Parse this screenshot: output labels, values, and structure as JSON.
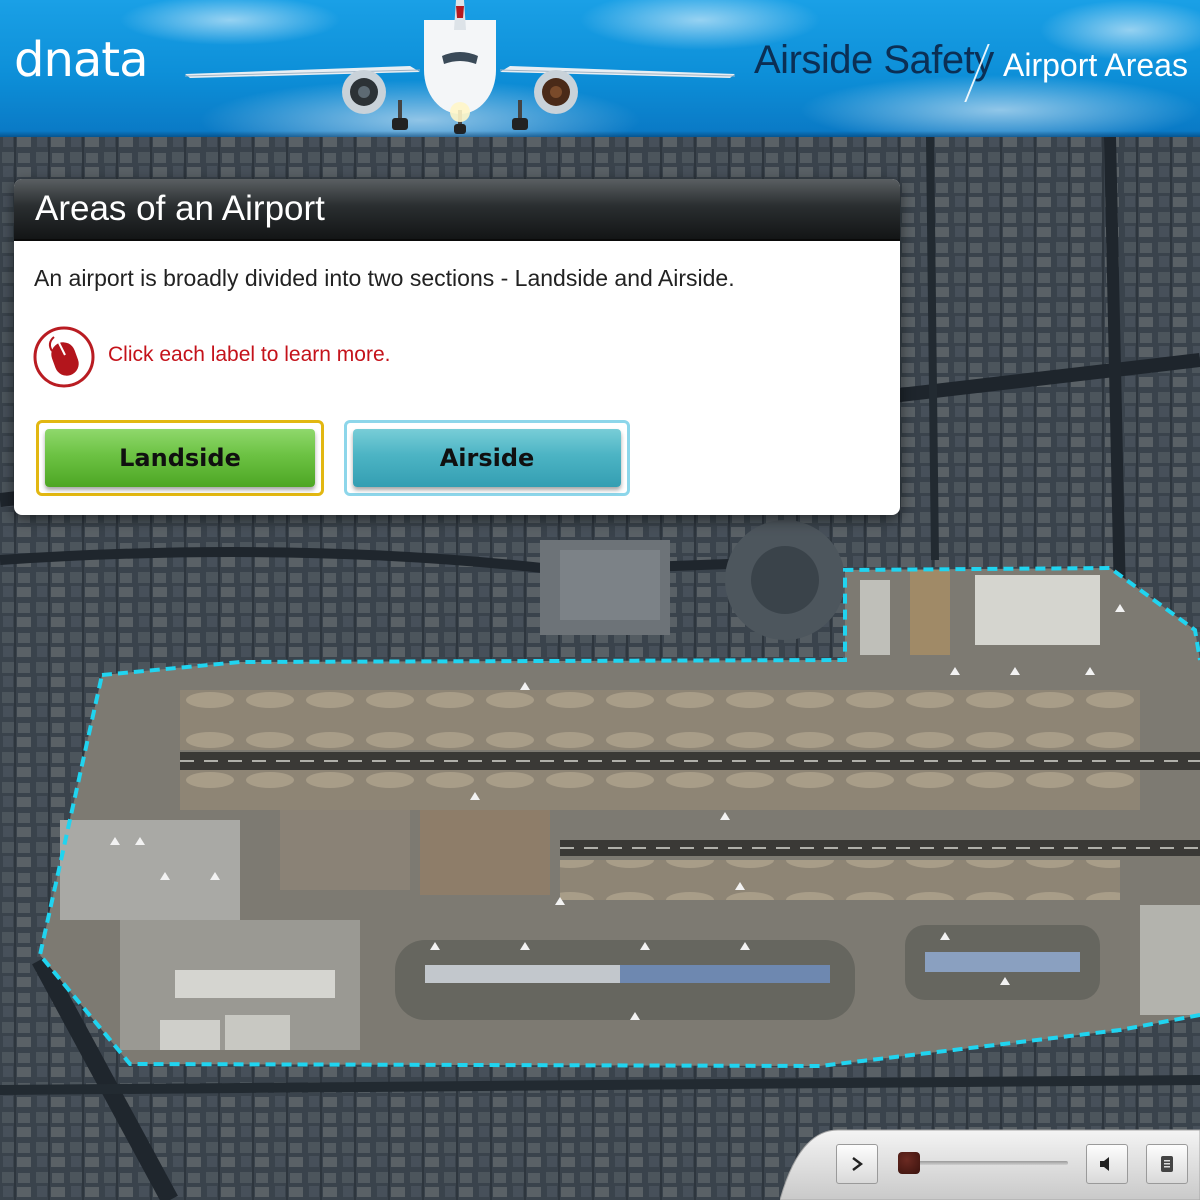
{
  "header": {
    "logo": "dnata",
    "course_title": "Airside Safety",
    "section_title": "Airport Areas"
  },
  "panel": {
    "title": "Areas of an Airport",
    "intro": "An airport is broadly divided into two sections - Landside and Airside.",
    "hint": "Click each label to learn more.",
    "hint_icon": "mouse-icon",
    "buttons": {
      "landside": "Landside",
      "airside": "Airside"
    }
  },
  "map": {
    "description_icon": "satellite-airport-map",
    "airside_boundary_color": "#20d4f0"
  },
  "player": {
    "play_icon": "play-icon",
    "volume_icon": "volume-icon",
    "notes_icon": "notes-icon",
    "progress": 0.03
  },
  "colors": {
    "header_blue": "#0d8fd8",
    "hint_red": "#c4121a",
    "landside_green": "#6cc243",
    "airside_teal": "#4cb4c4"
  }
}
